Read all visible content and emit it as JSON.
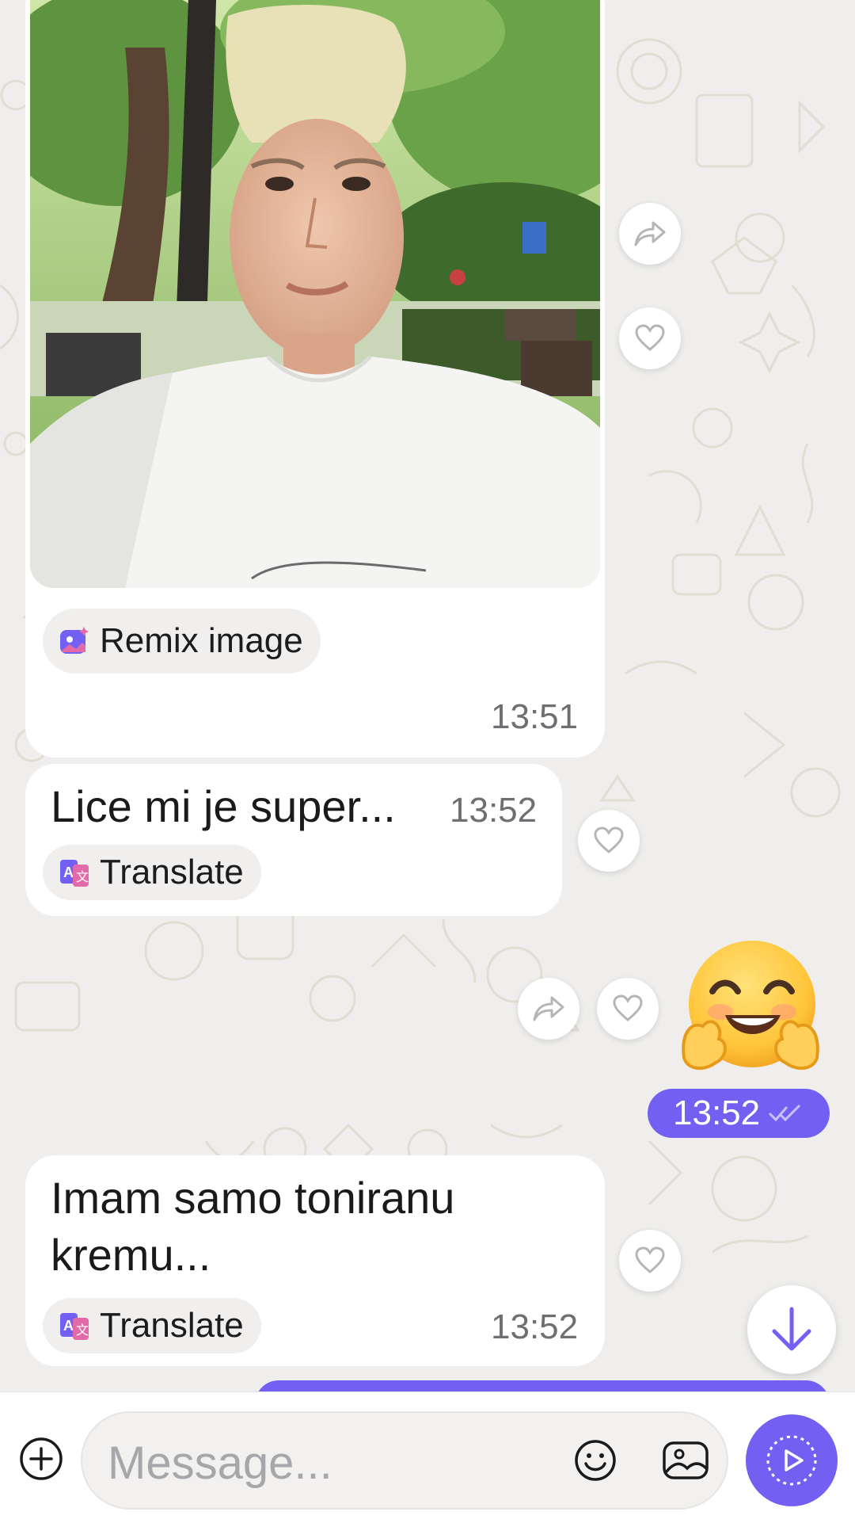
{
  "messages": {
    "photo": {
      "remix_label": "Remix image",
      "time": "13:51"
    },
    "msg1": {
      "text": "Lice mi je super...",
      "time": "13:52",
      "translate_label": "Translate"
    },
    "sent": {
      "sticker": "hugging-face emoji",
      "time": "13:52"
    },
    "msg2": {
      "line1": "Imam samo toniranu",
      "line2": "kremu...",
      "time": "13:52",
      "translate_label": "Translate"
    }
  },
  "composer": {
    "placeholder": "Message..."
  },
  "colors": {
    "accent": "#7360f2",
    "background": "#efeeec",
    "bubble": "#ffffff"
  }
}
